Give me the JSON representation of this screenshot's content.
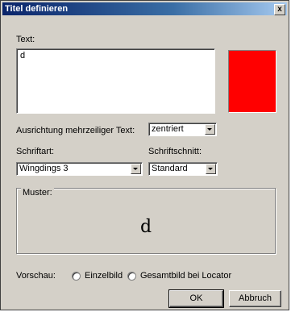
{
  "window": {
    "title": "Titel definieren",
    "close_label": "x"
  },
  "text_section": {
    "label": "Text:",
    "value": "d"
  },
  "color": {
    "swatch": "#ff0000"
  },
  "alignment": {
    "label": "Ausrichtung mehrzeiliger Text:",
    "selected": "zentriert"
  },
  "font": {
    "label": "Schriftart:",
    "selected": "Wingdings 3"
  },
  "font_style": {
    "label": "Schriftschnitt:",
    "selected": "Standard"
  },
  "sample": {
    "legend": "Muster:",
    "preview_text": "d"
  },
  "preview": {
    "label": "Vorschau:",
    "options": [
      "Einzelbild",
      "Gesamtbild bei Locator"
    ]
  },
  "buttons": {
    "ok": "OK",
    "cancel": "Abbruch"
  }
}
